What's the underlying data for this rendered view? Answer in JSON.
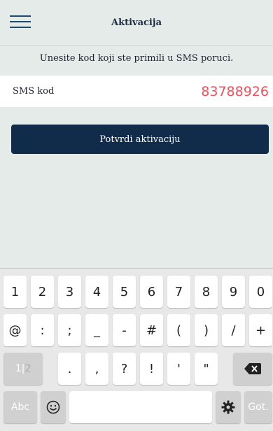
{
  "header": {
    "title": "Aktivacija",
    "menu_icon": "hamburger-menu-icon"
  },
  "instruction": "Unesite kod koji ste primili u SMS poruci.",
  "sms": {
    "label": "SMS kod",
    "value": "83788926",
    "value_color": "#f0525f"
  },
  "confirm_button": {
    "label": "Potvrdi aktivaciju",
    "color": "#102c4a"
  },
  "keyboard": {
    "row1": [
      "1",
      "2",
      "3",
      "4",
      "5",
      "6",
      "7",
      "8",
      "9",
      "0"
    ],
    "row2": [
      "@",
      ":",
      ";",
      "_",
      "-",
      "#",
      "(",
      ")",
      "/",
      "+"
    ],
    "row3": {
      "mode_1": "1",
      "mode_sep": "|",
      "mode_2": "2",
      "keys": [
        ".",
        ",",
        "?",
        "!",
        "'",
        "\""
      ],
      "backspace_icon": "backspace-icon"
    },
    "row4": {
      "abc": "Abc",
      "emoji_icon": "emoji-icon",
      "settings_icon": "gear-icon",
      "done": "Got."
    }
  }
}
